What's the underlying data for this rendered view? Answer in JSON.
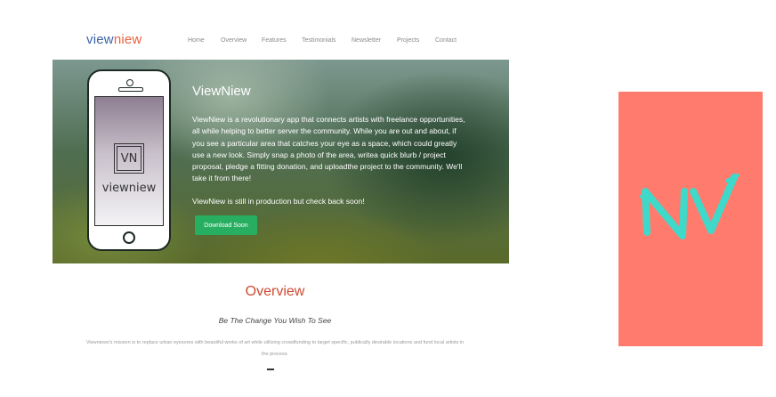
{
  "header": {
    "logo_part1": "view",
    "logo_part2": "niew",
    "nav": [
      "Home",
      "Overview",
      "Features",
      "Testimonials",
      "Newsletter",
      "Projects",
      "Contact"
    ]
  },
  "hero": {
    "title": "ViewNiew",
    "description": "ViewNiew is a revolutionary app that connects artists with freelance opportunities, all while helping to better server the community. While you are out and about, if you see a particular area that catches your eye as a space, which could greatly use a new look. Simply snap a photo of the area, writea quick blurb / project proposal, pledge a fitting donation, and uploadthe project to the community. We'll take it from there!",
    "status": "ViewNiew is still in production but check back soon!",
    "button_label": "Download Soon",
    "phone_logo": "VN",
    "phone_app_name": "viewniew"
  },
  "overview": {
    "title": "Overview",
    "subtitle": "Be The Change You Wish To See",
    "text": "Viewniews's mission is to replace urban eyesores with beautiful works of art while utilizing crowdfunding to target specific, publically desirable locations and fund local artists in the process."
  },
  "brand_tile": {
    "text": "NV",
    "bg_color": "#ff7b6e",
    "fg_color": "#3fd9c9"
  }
}
